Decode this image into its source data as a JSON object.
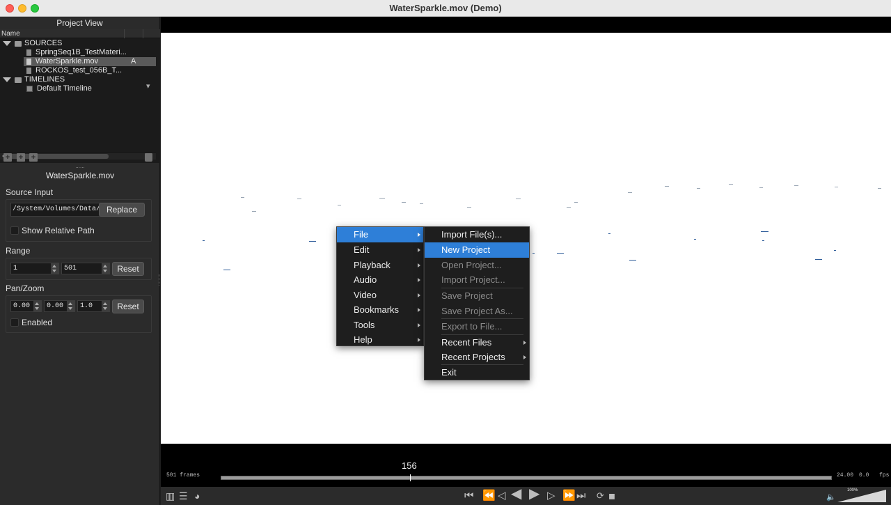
{
  "window": {
    "title": "WaterSparkle.mov (Demo)"
  },
  "project_view": {
    "header": "Project View",
    "column_name": "Name",
    "tree": {
      "sources_label": "SOURCES",
      "sources": [
        "SpringSeq1B_TestMateri...",
        "WaterSparkle.mov",
        "ROCKOS_test_056B_T..."
      ],
      "selected_marker": "A",
      "timelines_label": "TIMELINES",
      "timelines": [
        "Default Timeline"
      ]
    }
  },
  "inspector": {
    "dots": "......",
    "media_name": "WaterSparkle.mov",
    "source_input": {
      "label": "Source Input",
      "path": "/System/Volumes/Data/mc",
      "replace_label": "Replace",
      "show_relative_label": "Show Relative Path"
    },
    "range": {
      "label": "Range",
      "start": "1",
      "end": "501",
      "reset_label": "Reset"
    },
    "pan_zoom": {
      "label": "Pan/Zoom",
      "x": "0.00",
      "y": "0.00",
      "zoom": "1.0",
      "reset_label": "Reset",
      "enabled_label": "Enabled"
    }
  },
  "timeline": {
    "current_frame": "156",
    "total_frames_label": "501 frames",
    "fps_value": "24.00",
    "fps_rate": "0.0",
    "fps_label": "fps",
    "playhead_fraction": 0.31
  },
  "volume": {
    "percent": "100%"
  },
  "main_menu": {
    "items": [
      {
        "label": "File"
      },
      {
        "label": "Edit"
      },
      {
        "label": "Playback"
      },
      {
        "label": "Audio"
      },
      {
        "label": "Video"
      },
      {
        "label": "Bookmarks"
      },
      {
        "label": "Tools"
      },
      {
        "label": "Help"
      }
    ]
  },
  "file_menu": {
    "items": [
      {
        "label": "Import File(s)..."
      },
      {
        "label": "New Project"
      },
      {
        "label": "Open Project..."
      },
      {
        "label": "Import Project..."
      },
      {
        "label": "Save Project"
      },
      {
        "label": "Save Project As..."
      },
      {
        "label": "Export to File..."
      },
      {
        "label": "Recent Files"
      },
      {
        "label": "Recent Projects"
      },
      {
        "label": "Exit"
      }
    ]
  },
  "colors": {
    "menu_highlight": "#2e7fd8",
    "viewer_bg": "#ffffff",
    "panel_bg": "#2b2b2b"
  }
}
